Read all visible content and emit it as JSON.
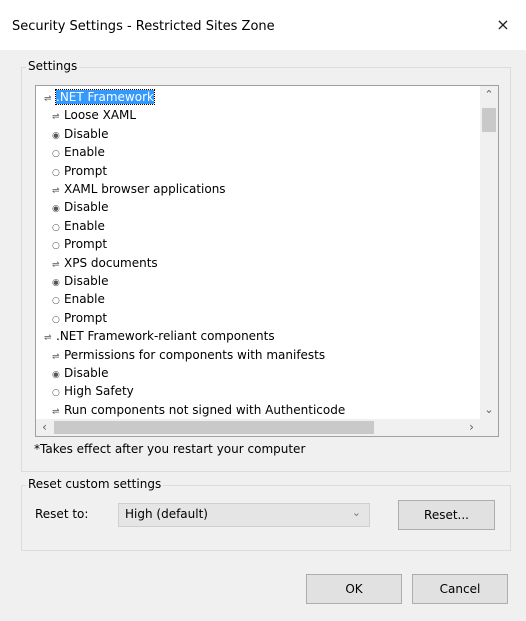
{
  "window": {
    "title": "Security Settings - Restricted Sites Zone",
    "close_glyph": "×"
  },
  "settings": {
    "group_label": "Settings",
    "tree": [
      {
        "indent": 0,
        "type": "folder",
        "label": ".NET Framework",
        "selected": true
      },
      {
        "indent": 1,
        "type": "folder",
        "label": "Loose XAML"
      },
      {
        "indent": 1,
        "type": "radio",
        "checked": true,
        "label": "Disable"
      },
      {
        "indent": 1,
        "type": "radio",
        "checked": false,
        "label": "Enable"
      },
      {
        "indent": 1,
        "type": "radio",
        "checked": false,
        "label": "Prompt"
      },
      {
        "indent": 1,
        "type": "folder",
        "label": "XAML browser applications"
      },
      {
        "indent": 1,
        "type": "radio",
        "checked": true,
        "label": "Disable"
      },
      {
        "indent": 1,
        "type": "radio",
        "checked": false,
        "label": "Enable"
      },
      {
        "indent": 1,
        "type": "radio",
        "checked": false,
        "label": "Prompt"
      },
      {
        "indent": 1,
        "type": "folder",
        "label": "XPS documents"
      },
      {
        "indent": 1,
        "type": "radio",
        "checked": true,
        "label": "Disable"
      },
      {
        "indent": 1,
        "type": "radio",
        "checked": false,
        "label": "Enable"
      },
      {
        "indent": 1,
        "type": "radio",
        "checked": false,
        "label": "Prompt"
      },
      {
        "indent": 0,
        "type": "folder",
        "label": ".NET Framework-reliant components"
      },
      {
        "indent": 1,
        "type": "folder",
        "label": "Permissions for components with manifests"
      },
      {
        "indent": 1,
        "type": "radio",
        "checked": true,
        "label": "Disable"
      },
      {
        "indent": 1,
        "type": "radio",
        "checked": false,
        "label": "High Safety"
      },
      {
        "indent": 1,
        "type": "folder",
        "label": "Run components not signed with Authenticode"
      }
    ],
    "note": "*Takes effect after you restart your computer"
  },
  "reset": {
    "group_label": "Reset custom settings",
    "reset_to_label": "Reset to:",
    "selected_value": "High (default)",
    "reset_button": "Reset..."
  },
  "footer": {
    "ok": "OK",
    "cancel": "Cancel"
  },
  "icons": {
    "chevron_up": "⌃",
    "chevron_down": "⌄",
    "chevron_left": "‹",
    "chevron_right": "›",
    "select_arrow": "⌄"
  },
  "colors": {
    "selection": "#3399ff",
    "window_bg": "#f0f0f0"
  }
}
